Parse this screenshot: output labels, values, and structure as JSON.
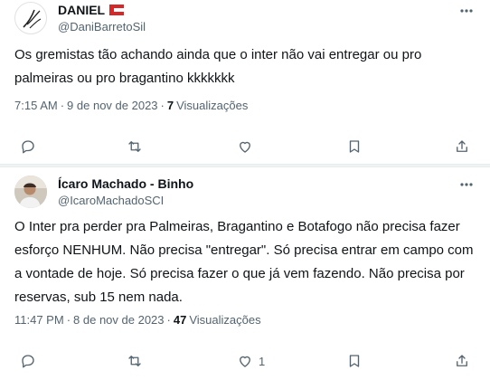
{
  "tweets": [
    {
      "display_name": "DANIEL",
      "handle": "@DaniBarretoSil",
      "text": "Os gremistas tão achando ainda que o inter não vai entregar ou pro palmeiras ou pro bragantino kkkkkkk",
      "time": "7:15 AM",
      "date": "9 de nov de 2023",
      "views_count": "7",
      "views_label": "Visualizações",
      "like_count": ""
    },
    {
      "display_name": "Ícaro Machado - Binho",
      "handle": "@IcaroMachadoSCI",
      "text": "O Inter pra perder pra Palmeiras, Bragantino e Botafogo não precisa fazer esforço NENHUM. Não precisa \"entregar\". Só precisa entrar em campo com a vontade de hoje. Só precisa fazer o que já vem fazendo. Não precisa por reservas, sub 15 nem nada.",
      "time": "11:47 PM",
      "date": "8 de nov de 2023",
      "views_count": "47",
      "views_label": "Visualizações",
      "like_count": "1"
    }
  ],
  "colors": {
    "text": "#0f1419",
    "secondary": "#536471",
    "separator": "#eff3f4"
  },
  "icons": [
    "more-icon",
    "reply-icon",
    "retweet-icon",
    "like-icon",
    "bookmark-icon",
    "share-icon",
    "flag-icon"
  ]
}
